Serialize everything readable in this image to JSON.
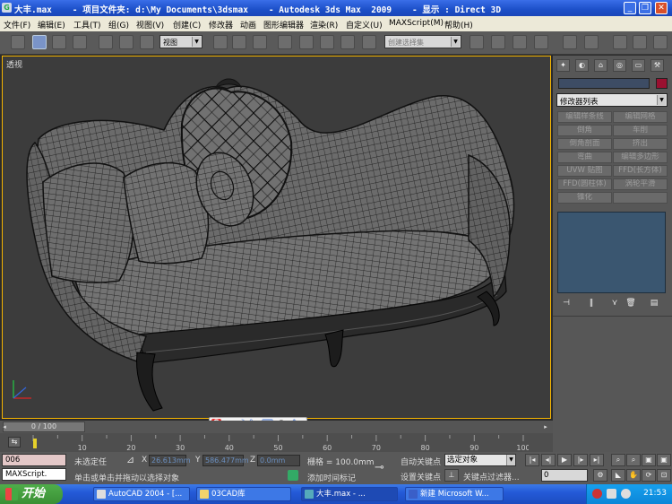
{
  "window": {
    "title": "大丰.max    - 项目文件夹: d:\\My Documents\\3dsmax    - Autodesk 3ds Max  2009    - 显示 : Direct 3D",
    "minimize_icon": "minimize-icon",
    "restore_icon": "restore-icon",
    "close_icon": "close-icon"
  },
  "menu": [
    "文件(F)",
    "编辑(E)",
    "工具(T)",
    "组(G)",
    "视图(V)",
    "创建(C)",
    "修改器",
    "动画",
    "图形编辑器",
    "渲染(R)",
    "自定义(U)",
    "MAXScript(M)",
    "帮助(H)"
  ],
  "toolbar": {
    "refcoord_value": "视图",
    "selection_set_placeholder": "创建选择集"
  },
  "viewport": {
    "label": "透视",
    "content": "sofa-wireframe-model"
  },
  "command_panel": {
    "tabs": [
      "create-icon",
      "modify-icon",
      "hierarchy-icon",
      "motion-icon",
      "display-icon",
      "utilities-icon"
    ],
    "modifier_list": "修改器列表",
    "object_color": "#9a1030",
    "modifier_buttons": [
      "编辑样条线",
      "编辑网格",
      "倒角",
      "车削",
      "倒角剖面",
      "挤出",
      "弯曲",
      "编辑多边形",
      "UVW 贴图",
      "FFD(长方体)",
      "FFD(圆柱体)",
      "涡轮平滑",
      "锥化",
      ""
    ],
    "stack_buttons": [
      "pin-stack-icon",
      "show-end-result-icon",
      "make-unique-icon",
      "remove-modifier-icon",
      "configure-sets-icon"
    ]
  },
  "ime": {
    "s_logo": "S",
    "lang": "中",
    "moon": "☽",
    "punct": "°,",
    "keyboard": "⌨",
    "user": "●",
    "settings": "✎"
  },
  "timeline": {
    "frame": "0 / 100",
    "ticks": [
      10,
      20,
      30,
      40,
      50,
      60,
      70,
      80,
      90,
      100
    ]
  },
  "status": {
    "script_field_top": "006",
    "script_field_bottom": "MAXScript.",
    "selection_status": "未选定任",
    "prompt": "单击或单击并拖动以选择对象",
    "x_label": "X",
    "x_value": "26.613mm",
    "y_label": "Y",
    "y_value": "586.477mm",
    "z_label": "Z",
    "z_value": "0.0mm",
    "grid": "栅格 = 100.0mm",
    "add_time_tag": "添加时间标记",
    "auto_key": "自动关键点",
    "set_key": "设置关键点",
    "selected_object": "选定对象",
    "key_filters": "关键点过滤器...",
    "current_frame": "0"
  },
  "taskbar": {
    "start": "开始",
    "tasks": [
      "AutoCAD 2004 - [...",
      "03CAD库",
      "大丰.max   - ...",
      "新建 Microsoft W..."
    ],
    "clock": "21:53"
  }
}
